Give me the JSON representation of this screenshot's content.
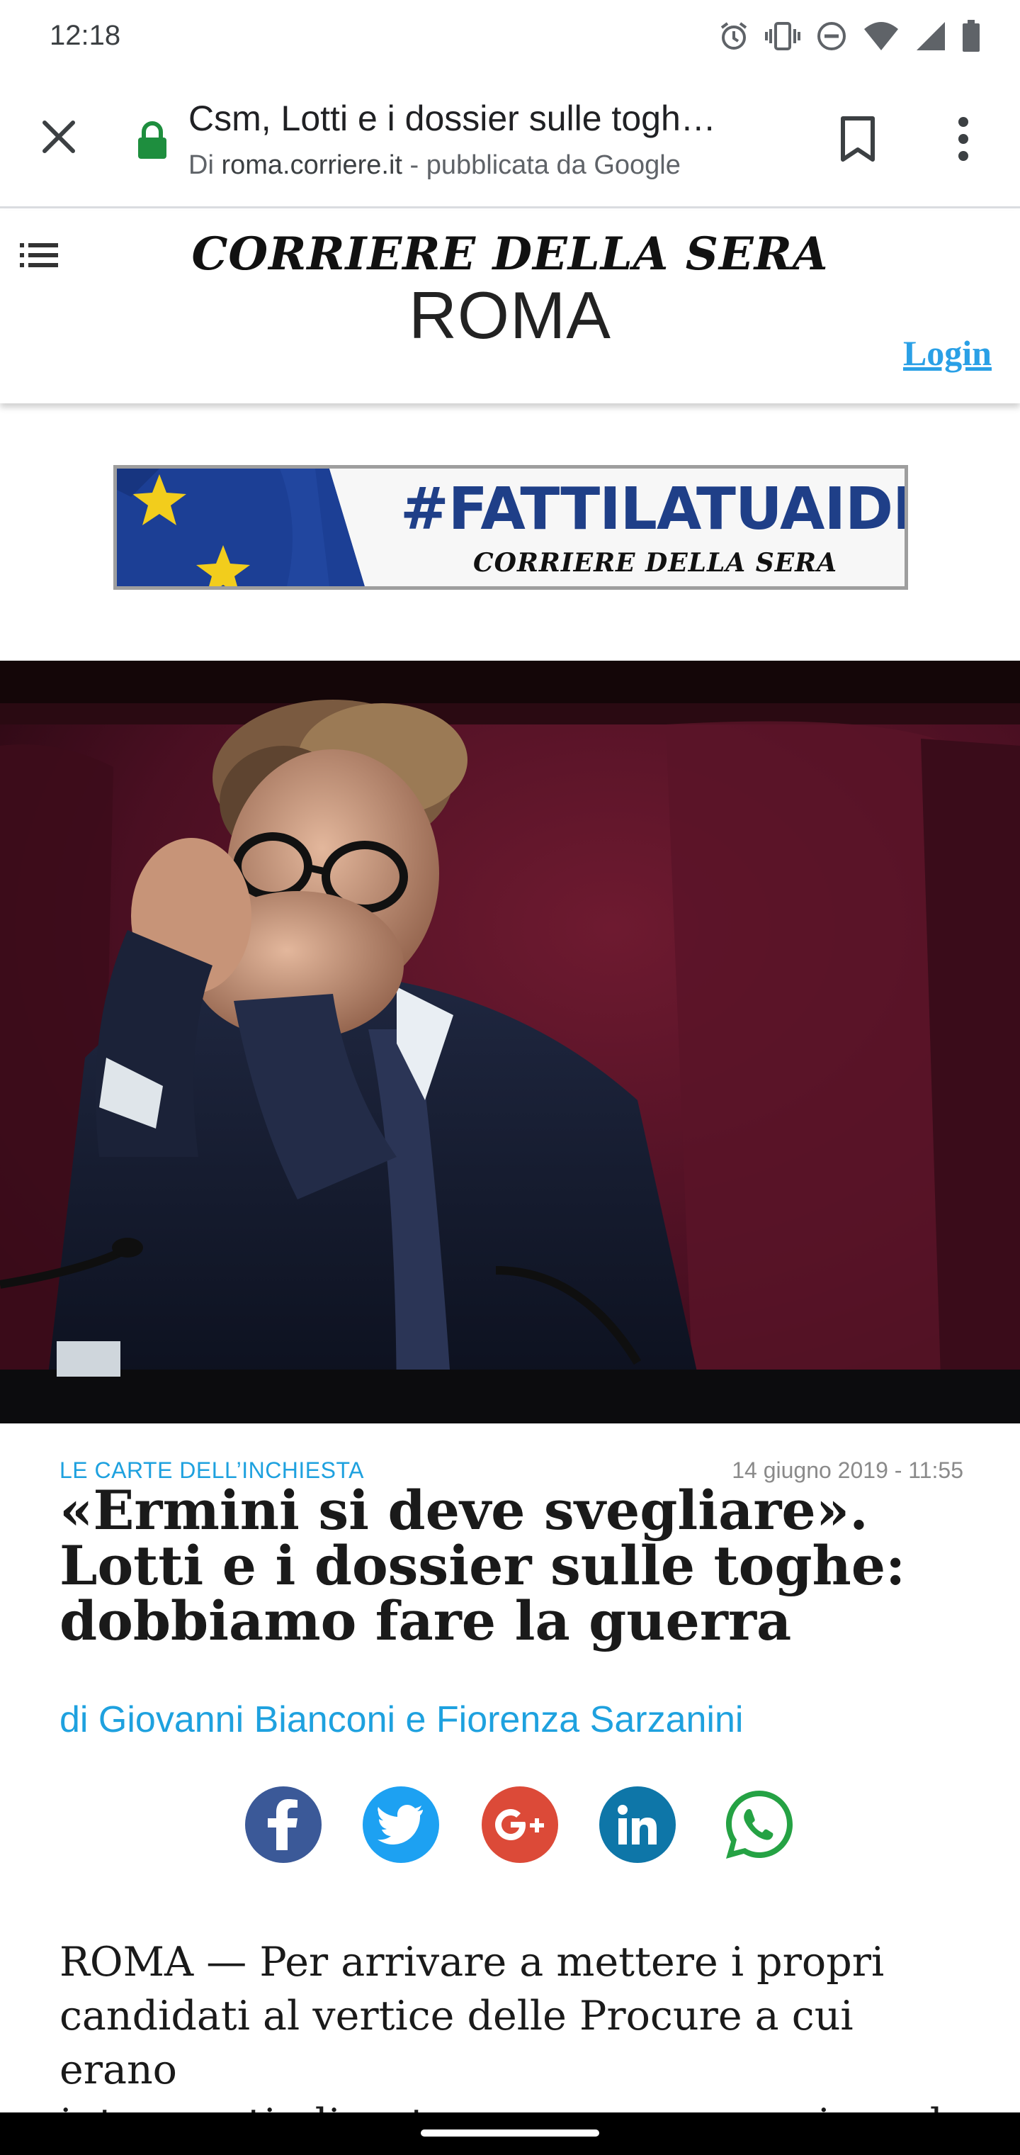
{
  "status_bar": {
    "time": "12:18",
    "icons": [
      "alarm-icon",
      "vibrate-icon",
      "do-not-disturb-icon",
      "wifi-icon",
      "signal-icon",
      "battery-icon"
    ]
  },
  "toolbar": {
    "title": "Csm, Lotti e i dossier sulle togh…",
    "subtitle_prefix": "Di ",
    "subtitle_domain": "roma.corriere.it",
    "subtitle_suffix": " - pubblicata da Google",
    "icons": [
      "close-icon",
      "lock-icon",
      "bookmark-icon",
      "more-vert-icon"
    ]
  },
  "site_header": {
    "brand": "CORRIERE DELLA SERA",
    "section": "ROMA",
    "login": "Login"
  },
  "banner": {
    "hashtag": "#FATTILATUAIDEA",
    "brand": "CORRIERE DELLA SERA"
  },
  "article": {
    "kicker": "LE CARTE DELL’INCHIESTA",
    "date": "14 giugno 2019 - 11:55",
    "headline_lines": [
      "«Ermini si deve svegliare».",
      "Lotti e i dossier sulle toghe:",
      "dobbiamo fare la guerra"
    ],
    "byline": "di Giovanni Bianconi e Fiorenza Sarzanini",
    "body_lines": [
      "ROMA — Per arrivare a mettere i propri",
      "candidati al vertice delle Procure a cui erano",
      "interessati, discutevano su come aggirare le"
    ]
  },
  "share": [
    {
      "name": "facebook",
      "color": "#3b5998",
      "icon": "facebook-icon"
    },
    {
      "name": "twitter",
      "color": "#1da1f2",
      "icon": "twitter-icon"
    },
    {
      "name": "google-plus",
      "color": "#dc4a38",
      "icon": "google-plus-icon"
    },
    {
      "name": "linkedin",
      "color": "#0e76a8",
      "icon": "linkedin-icon"
    },
    {
      "name": "whatsapp",
      "color": "#25a244",
      "icon": "whatsapp-icon"
    }
  ],
  "colors": {
    "accent_blue": "#1ea1df",
    "login_blue": "#2aa0e6",
    "banner_navy": "#1f3f88",
    "lock_green": "#1e8e3e"
  }
}
